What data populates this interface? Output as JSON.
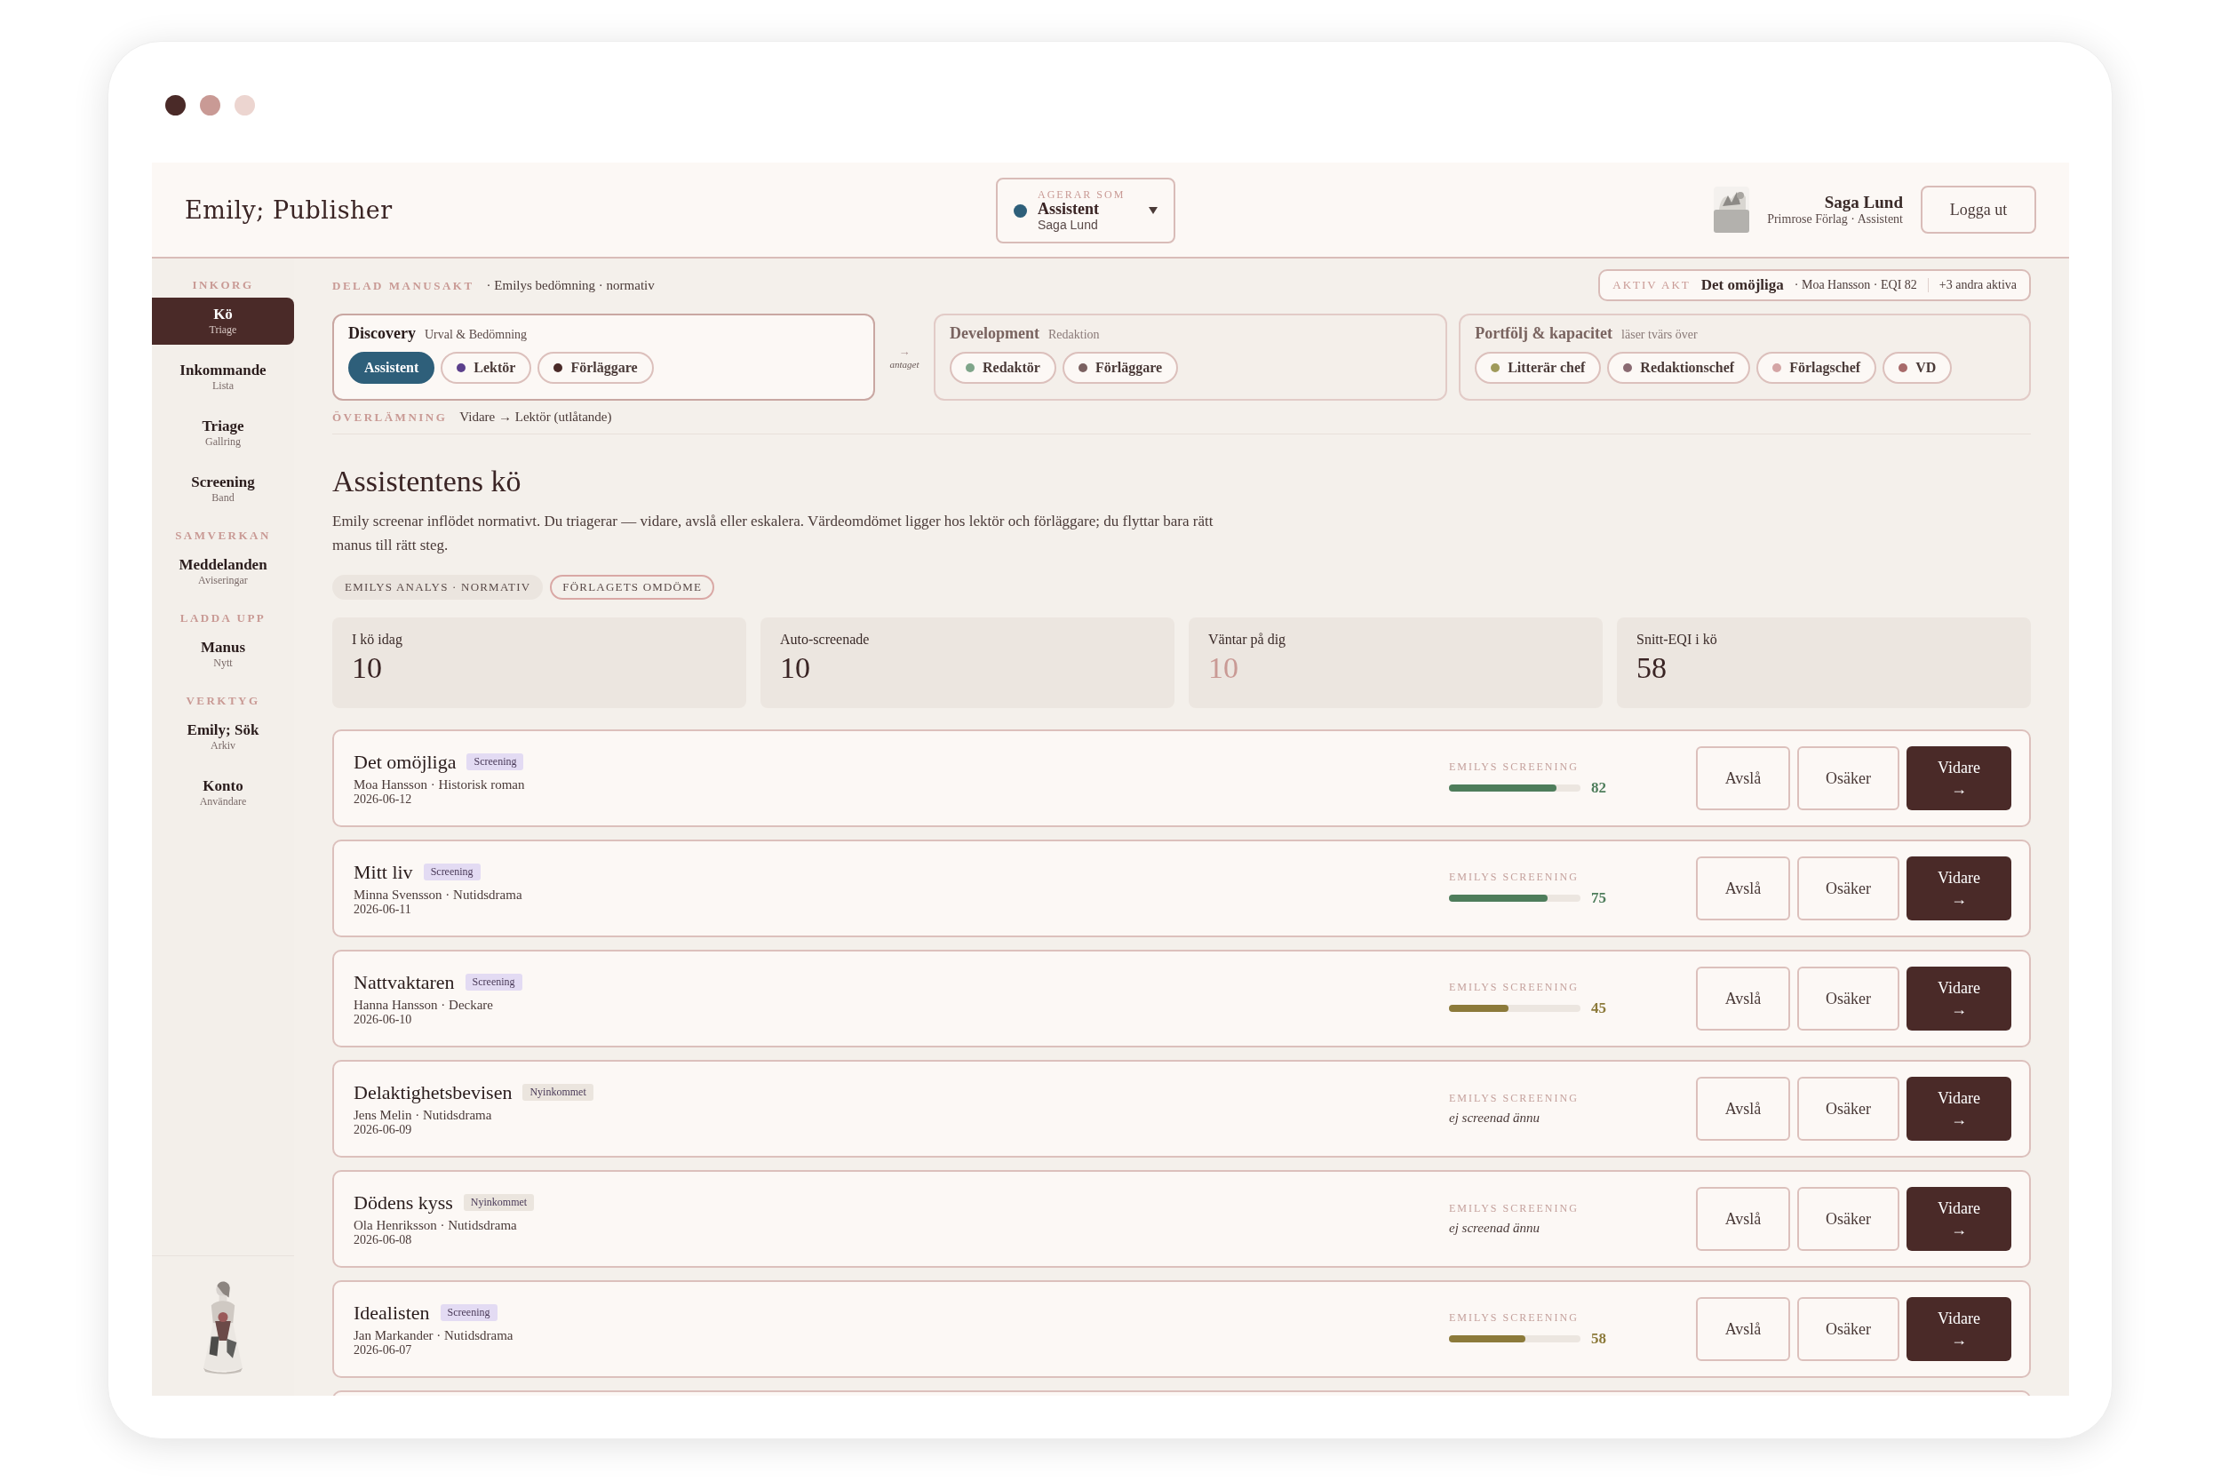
{
  "app_title": "Emily; Publisher",
  "acting_as": {
    "label": "AGERAR SOM",
    "role": "Assistent",
    "name": "Saga Lund",
    "color": "#2e5f7a"
  },
  "user": {
    "name": "Saga Lund",
    "org": "Primrose Förlag · Assistent"
  },
  "logout": "Logga ut",
  "sidebar": [
    {
      "heading": "INKORG",
      "items": [
        {
          "label": "Kö",
          "sub": "Triage",
          "selected": true
        },
        {
          "label": "Inkommande",
          "sub": "Lista",
          "selected": false
        },
        {
          "label": "Triage",
          "sub": "Gallring",
          "selected": false
        },
        {
          "label": "Screening",
          "sub": "Band",
          "selected": false
        }
      ]
    },
    {
      "heading": "SAMVERKAN",
      "items": [
        {
          "label": "Meddelanden",
          "sub": "Aviseringar",
          "selected": false
        }
      ]
    },
    {
      "heading": "LADDA UPP",
      "items": [
        {
          "label": "Manus",
          "sub": "Nytt",
          "selected": false
        }
      ]
    },
    {
      "heading": "VERKTYG",
      "items": [
        {
          "label": "Emily; Sök",
          "sub": "Arkiv",
          "selected": false
        },
        {
          "label": "Konto",
          "sub": "Användare",
          "selected": false
        }
      ]
    }
  ],
  "shared_file": {
    "label": "DELAD MANUSAKT",
    "note": "· Emilys bedömning · normativ"
  },
  "active_file": {
    "label": "AKTIV AKT",
    "title": "Det omöjliga",
    "meta": "· Moa Hansson · EQI 82",
    "others": "+3 andra aktiva"
  },
  "phases": [
    {
      "title": "Discovery",
      "sub": "Urval & Bedömning",
      "active": true,
      "roles": [
        {
          "label": "Assistent",
          "color": "#2e5f7a",
          "selected": true
        },
        {
          "label": "Lektör",
          "color": "#5b3f8c",
          "selected": false
        },
        {
          "label": "Förläggare",
          "color": "#4a2a28",
          "selected": false
        }
      ]
    },
    {
      "title": "Development",
      "sub": "Redaktion",
      "active": false,
      "roles": [
        {
          "label": "Redaktör",
          "color": "#7fa58a",
          "selected": false
        },
        {
          "label": "Förläggare",
          "color": "#7a6060",
          "selected": false
        }
      ]
    },
    {
      "title": "Portfölj & kapacitet",
      "sub": "läser tvärs över",
      "active": false,
      "roles": [
        {
          "label": "Litterär chef",
          "color": "#a09a5a",
          "selected": false
        },
        {
          "label": "Redaktionschef",
          "color": "#8a6a72",
          "selected": false
        },
        {
          "label": "Förlagschef",
          "color": "#d4a5a5",
          "selected": false
        },
        {
          "label": "VD",
          "color": "#a86a6a",
          "selected": false
        }
      ]
    }
  ],
  "phase_link": {
    "arrow": "→",
    "label": "antaget"
  },
  "handover": {
    "label": "ÖVERLÄMNING",
    "text": "Vidare → Lektör (utlåtande)"
  },
  "heading": "Assistentens kö",
  "description": "Emily screenar inflödet normativt. Du triagerar — vidare, avslå eller eskalera. Värdeomdömet ligger hos lektör och förläggare; du flyttar bara rätt manus till rätt steg.",
  "views": [
    {
      "label": "EMILYS ANALYS · NORMATIV",
      "selected": true
    },
    {
      "label": "FÖRLAGETS OMDÖME",
      "selected": false
    }
  ],
  "stats": [
    {
      "label": "I kö idag",
      "value": "10",
      "highlight": false
    },
    {
      "label": "Auto-screenade",
      "value": "10",
      "highlight": false
    },
    {
      "label": "Väntar på dig",
      "value": "10",
      "highlight": true
    },
    {
      "label": "Snitt-EQI i kö",
      "value": "58",
      "highlight": false
    }
  ],
  "queue": [
    {
      "title": "Det omöjliga",
      "badge": {
        "label": "Screening",
        "color": "#e3dbf3"
      },
      "meta": "Moa Hansson · Historisk roman",
      "date": "2026-06-12",
      "screening": {
        "label": "EMILYS SCREENING",
        "kind": "score",
        "level": 0.82,
        "score": "82",
        "color": "#4e7d5b"
      },
      "actions": {
        "reject": "Avslå",
        "unsure": "Osäker",
        "forward": "Vidare",
        "arrow": "→"
      }
    },
    {
      "title": "Mitt liv",
      "badge": {
        "label": "Screening",
        "color": "#e3dbf3"
      },
      "meta": "Minna Svensson · Nutidsdrama",
      "date": "2026-06-11",
      "screening": {
        "label": "EMILYS SCREENING",
        "kind": "score",
        "level": 0.75,
        "score": "75",
        "color": "#4e7d5b"
      },
      "actions": {
        "reject": "Avslå",
        "unsure": "Osäker",
        "forward": "Vidare",
        "arrow": "→"
      }
    },
    {
      "title": "Nattvaktaren",
      "badge": {
        "label": "Screening",
        "color": "#e3dbf3"
      },
      "meta": "Hanna Hansson · Deckare",
      "date": "2026-06-10",
      "screening": {
        "label": "EMILYS SCREENING",
        "kind": "score",
        "level": 0.45,
        "score": "45",
        "color": "#8c7a3a"
      },
      "actions": {
        "reject": "Avslå",
        "unsure": "Osäker",
        "forward": "Vidare",
        "arrow": "→"
      }
    },
    {
      "title": "Delaktighetsbevisen",
      "badge": {
        "label": "Nyinkommet",
        "color": "#ebe5de"
      },
      "meta": "Jens Melin · Nutidsdrama",
      "date": "2026-06-09",
      "screening": {
        "label": "EMILYS SCREENING",
        "kind": "pending",
        "text": "ej screenad ännu"
      },
      "actions": {
        "reject": "Avslå",
        "unsure": "Osäker",
        "forward": "Vidare",
        "arrow": "→"
      }
    },
    {
      "title": "Dödens kyss",
      "badge": {
        "label": "Nyinkommet",
        "color": "#ebe5de"
      },
      "meta": "Ola Henriksson · Nutidsdrama",
      "date": "2026-06-08",
      "screening": {
        "label": "EMILYS SCREENING",
        "kind": "pending",
        "text": "ej screenad ännu"
      },
      "actions": {
        "reject": "Avslå",
        "unsure": "Osäker",
        "forward": "Vidare",
        "arrow": "→"
      }
    },
    {
      "title": "Idealisten",
      "badge": {
        "label": "Screening",
        "color": "#e3dbf3"
      },
      "meta": "Jan Markander · Nutidsdrama",
      "date": "2026-06-07",
      "screening": {
        "label": "EMILYS SCREENING",
        "kind": "score",
        "level": 0.58,
        "score": "58",
        "color": "#8c7a3a"
      },
      "actions": {
        "reject": "Avslå",
        "unsure": "Osäker",
        "forward": "Vidare",
        "arrow": "→"
      }
    }
  ]
}
